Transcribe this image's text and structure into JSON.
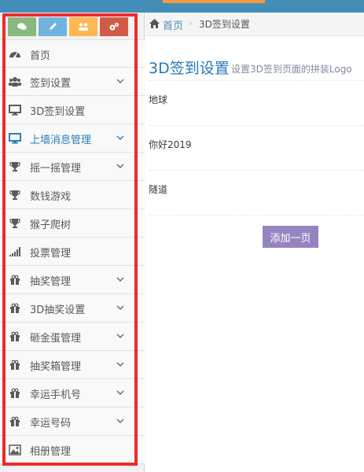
{
  "breadcrumb": {
    "home": "首页",
    "current": "3D签到设置"
  },
  "page": {
    "title": "3D签到设置",
    "subtitle": "设置3D签到页面的拼装Logo"
  },
  "rows": [
    {
      "text": "地球"
    },
    {
      "text": "你好2019"
    },
    {
      "text": "隧道"
    }
  ],
  "add_button": "添加一页",
  "shortcuts": [
    {
      "icon": "comment-icon",
      "color": "#87b87f"
    },
    {
      "icon": "pencil-icon",
      "color": "#6fb3e0"
    },
    {
      "icon": "group-icon",
      "color": "#ffb752"
    },
    {
      "icon": "cogs-icon",
      "color": "#d15b47"
    }
  ],
  "sidebar": {
    "items": [
      {
        "label": "首页",
        "icon": "dashboard-icon",
        "has_submenu": false
      },
      {
        "label": "签到设置",
        "icon": "users-icon",
        "has_submenu": true
      },
      {
        "label": "3D签到设置",
        "icon": "desktop-icon",
        "has_submenu": false
      },
      {
        "label": "上墙消息管理",
        "icon": "desktop-icon",
        "has_submenu": true,
        "active": true
      },
      {
        "label": "摇一摇管理",
        "icon": "trophy-icon",
        "has_submenu": true
      },
      {
        "label": "数钱游戏",
        "icon": "trophy-icon",
        "has_submenu": false
      },
      {
        "label": "猴子爬树",
        "icon": "trophy-icon",
        "has_submenu": false
      },
      {
        "label": "投票管理",
        "icon": "signal-icon",
        "has_submenu": false
      },
      {
        "label": "抽奖管理",
        "icon": "gift-icon",
        "has_submenu": true
      },
      {
        "label": "3D抽奖设置",
        "icon": "gift-icon",
        "has_submenu": true
      },
      {
        "label": "砸金蛋管理",
        "icon": "gift-icon",
        "has_submenu": true
      },
      {
        "label": "抽奖箱管理",
        "icon": "gift-icon",
        "has_submenu": true
      },
      {
        "label": "幸运手机号",
        "icon": "gift-icon",
        "has_submenu": true
      },
      {
        "label": "幸运号码",
        "icon": "gift-icon",
        "has_submenu": true
      },
      {
        "label": "相册管理",
        "icon": "picture-icon",
        "has_submenu": false
      }
    ]
  },
  "colors": {
    "topbar": "#438eb9",
    "highlight_box": "#ee2b2b",
    "active_item": "#2b7dbc",
    "title": "#2679b5",
    "button": "#9585bf"
  }
}
